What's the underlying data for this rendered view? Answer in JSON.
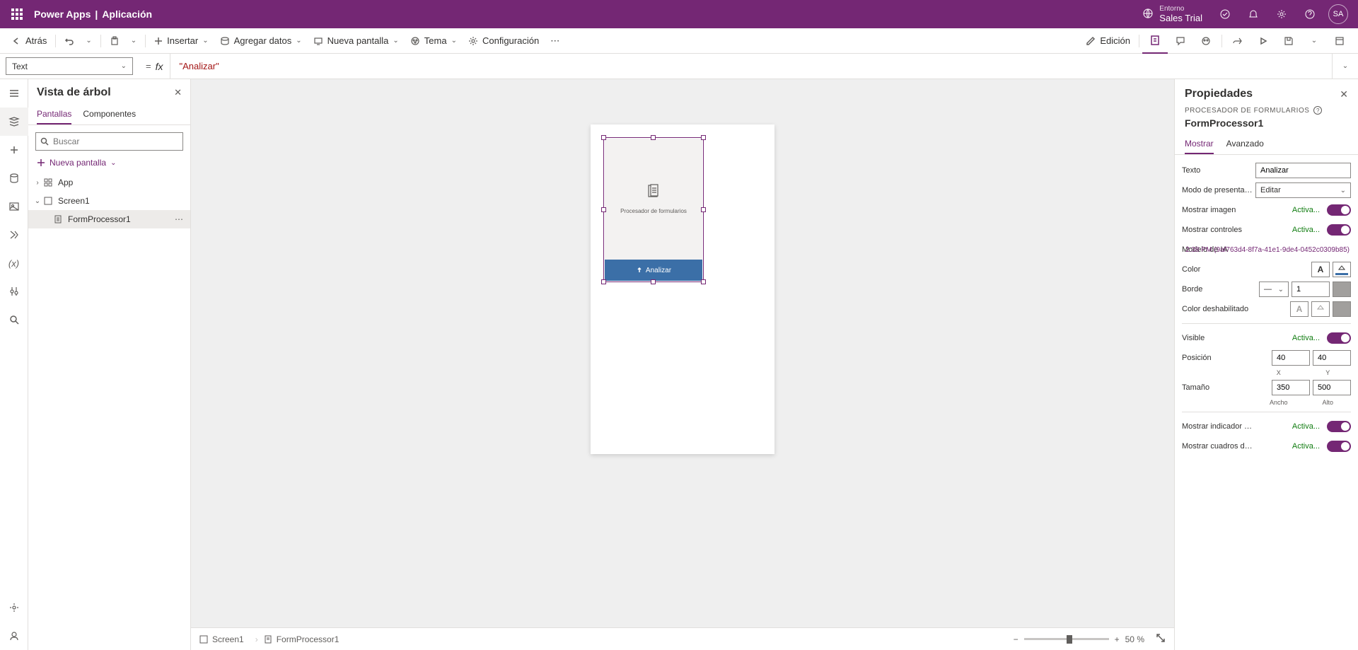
{
  "header": {
    "brand": "Power Apps",
    "appName": "Aplicación",
    "envLabel": "Entorno",
    "envName": "Sales Trial",
    "avatar": "SA"
  },
  "cmdbar": {
    "back": "Atrás",
    "insert": "Insertar",
    "addData": "Agregar datos",
    "newScreen": "Nueva pantalla",
    "theme": "Tema",
    "settings": "Configuración",
    "edit": "Edición"
  },
  "formula": {
    "prop": "Text",
    "value": "\"Analizar\""
  },
  "tree": {
    "title": "Vista de árbol",
    "tabScreens": "Pantallas",
    "tabComponents": "Componentes",
    "searchPlaceholder": "Buscar",
    "newScreen": "Nueva pantalla",
    "app": "App",
    "screen1": "Screen1",
    "fp": "FormProcessor1"
  },
  "canvas": {
    "fpLabel": "Procesador de formularios",
    "analyze": "Analizar"
  },
  "statusbar": {
    "screen": "Screen1",
    "fp": "FormProcessor1",
    "zoom": "50",
    "pct": "%"
  },
  "props": {
    "title": "Propiedades",
    "kind": "PROCESADOR DE FORMULARIOS",
    "cname": "FormProcessor1",
    "tabShow": "Mostrar",
    "tabAdv": "Avanzado",
    "text": {
      "label": "Texto",
      "value": "Analizar"
    },
    "displayMode": {
      "label": "Modo de presentaci...",
      "value": "Editar"
    },
    "showImage": {
      "label": "Mostrar imagen",
      "state": "Activa..."
    },
    "showControls": {
      "label": "Mostrar controles",
      "state": "Activa..."
    },
    "modelIA": {
      "label": "Modelo de IA",
      "value": "2:38 PM (9af763d4-8f7a-41e1-9de4-0452c0309b85)"
    },
    "color": {
      "label": "Color"
    },
    "border": {
      "label": "Borde",
      "width": "1"
    },
    "disabledColor": {
      "label": "Color deshabilitado"
    },
    "visible": {
      "label": "Visible",
      "state": "Activa..."
    },
    "position": {
      "label": "Posición",
      "x": "40",
      "y": "40",
      "xLbl": "X",
      "yLbl": "Y"
    },
    "size": {
      "label": "Tamaño",
      "w": "350",
      "h": "500",
      "wLbl": "Ancho",
      "hLbl": "Alto"
    },
    "showIndicator": {
      "label": "Mostrar indicador d...",
      "state": "Activa..."
    },
    "showBoxes": {
      "label": "Mostrar cuadros de ...",
      "state": "Activa..."
    }
  }
}
